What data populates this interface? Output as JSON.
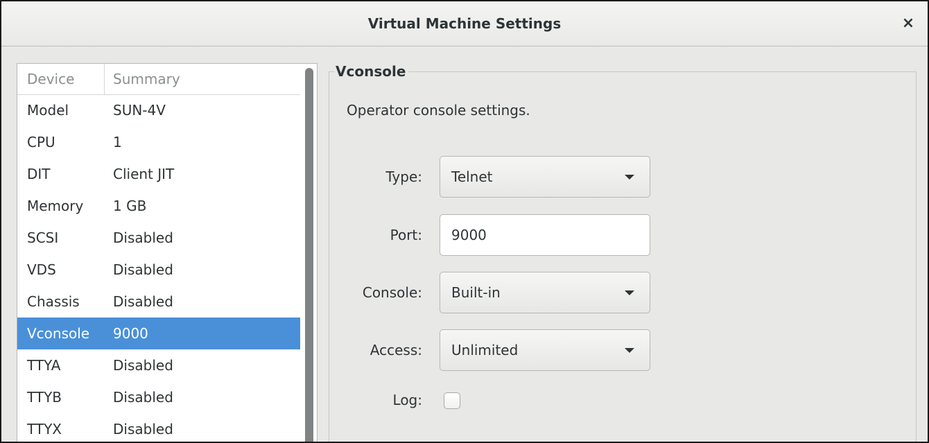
{
  "window": {
    "title": "Virtual Machine Settings",
    "close_label": "×"
  },
  "device_list": {
    "columns": [
      "Device",
      "Summary"
    ],
    "rows": [
      {
        "device": "Model",
        "summary": "SUN-4V"
      },
      {
        "device": "CPU",
        "summary": "1"
      },
      {
        "device": "DIT",
        "summary": "Client JIT"
      },
      {
        "device": "Memory",
        "summary": "1 GB"
      },
      {
        "device": "SCSI",
        "summary": "Disabled"
      },
      {
        "device": "VDS",
        "summary": "Disabled"
      },
      {
        "device": "Chassis",
        "summary": "Disabled"
      },
      {
        "device": "Vconsole",
        "summary": "9000"
      },
      {
        "device": "TTYA",
        "summary": "Disabled"
      },
      {
        "device": "TTYB",
        "summary": "Disabled"
      },
      {
        "device": "TTYX",
        "summary": "Disabled"
      }
    ],
    "selected_device": "Vconsole"
  },
  "vconsole": {
    "section_title": "Vconsole",
    "description": "Operator console settings.",
    "type_label": "Type:",
    "type_value": "Telnet",
    "port_label": "Port:",
    "port_value": "9000",
    "console_label": "Console:",
    "console_value": "Built-in",
    "access_label": "Access:",
    "access_value": "Unlimited",
    "log_label": "Log:",
    "log_checked": false
  },
  "colors": {
    "selection": "#4a90d9",
    "window_bg": "#e8e8e7",
    "text": "#2e3436"
  }
}
